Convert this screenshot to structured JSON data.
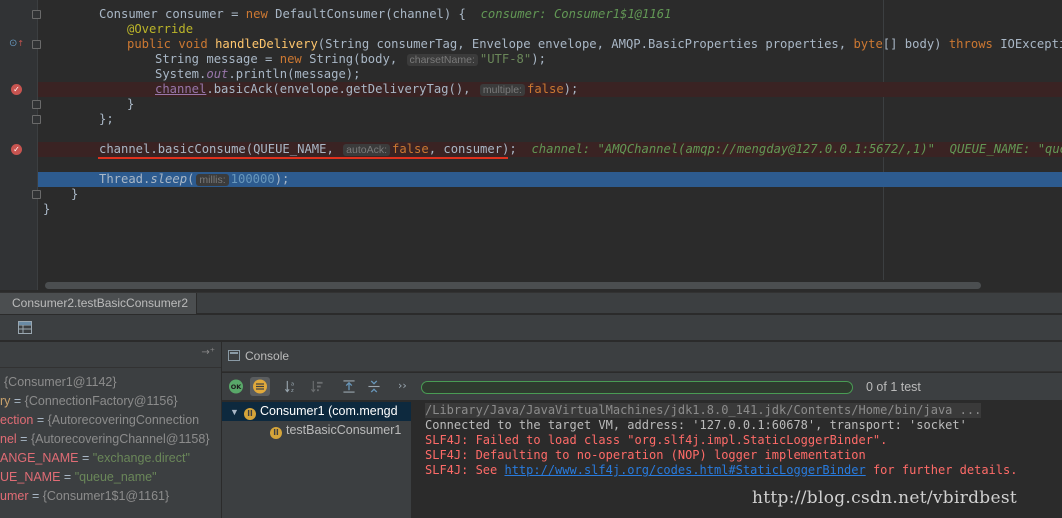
{
  "editor": {
    "lines": {
      "l1": {
        "kw_new": "new",
        "type": "Consumer",
        "var": "consumer",
        "eq": " = ",
        "cls": "DefaultConsumer",
        "args": "(channel) {",
        "inline": "consumer: Consumer1$1@1161"
      },
      "l2": {
        "annotation": "@Override"
      },
      "l3": {
        "kw": "public void",
        "method": "handleDelivery",
        "params_a": "(String consumerTag, Envelope envelope, AMQP.BasicProperties properties, ",
        "kw_byte": "byte",
        "params_b": "[] body) ",
        "kw_throws": "throws",
        "params_c": " IOException {"
      },
      "l4": {
        "pre": "String message = ",
        "kw_new": "new",
        "mid": " String(body, ",
        "hint": "charsetName:",
        "str": "\"UTF-8\"",
        "post": ");"
      },
      "l5": {
        "pre": "System.",
        "field": "out",
        "post": ".println(message);"
      },
      "l6": {
        "field": "channel",
        "mid": ".basicAck(envelope.getDeliveryTag(), ",
        "hint": "multiple:",
        "kw": "false",
        "post": ");"
      },
      "l7": {
        "text": "}"
      },
      "l8": {
        "text": "};"
      },
      "l9": {
        "pre": "channel.basicConsume(QUEUE_NAME, ",
        "hint": "autoAck:",
        "kw": "false",
        "post": ", consumer);",
        "inline": "channel: \"AMQChannel(amqp://mengday@127.0.0.1:5672/,1)\"  QUEUE_NAME: \"queue_na"
      },
      "l10": {
        "pre": "Thread.",
        "method": "sleep",
        "open": "(",
        "hint": "millis:",
        "num": "100000",
        "post": ");"
      },
      "l11": {
        "text": "}"
      },
      "l12": {
        "text": "}"
      }
    }
  },
  "debug": {
    "tab_label": "Consumer2.testBasicConsumer2",
    "variables": [
      {
        "name": "",
        "value": "{Consumer1@1142}"
      },
      {
        "name": "ry",
        "value": "{ConnectionFactory@1156}"
      },
      {
        "name": "ection",
        "value": "{AutorecoveringConnection"
      },
      {
        "name": "nel",
        "value": "{AutorecoveringChannel@1158}"
      },
      {
        "name": "ANGE_NAME",
        "value": "\"exchange.direct\""
      },
      {
        "name": "UE_NAME",
        "value": "\"queue_name\""
      },
      {
        "name": "umer",
        "value": "{Consumer1$1@1161}"
      }
    ],
    "variable_eq": " = "
  },
  "console": {
    "title": "Console",
    "test_count": "0 of 1 test",
    "tree": [
      {
        "label": "Consumer1 (com.mengd"
      },
      {
        "label": "testBasicConsumer1"
      }
    ],
    "output": {
      "cmd": "/Library/Java/JavaVirtualMachines/jdk1.8.0_141.jdk/Contents/Home/bin/java ...",
      "connected": "Connected to the target VM, address: '127.0.0.1:60678', transport: 'socket'",
      "err1": "SLF4J: Failed to load class \"org.slf4j.impl.StaticLoggerBinder\".",
      "err2": "SLF4J: Defaulting to no-operation (NOP) logger implementation",
      "err3_pre": "SLF4J: See ",
      "err3_link": "http://www.slf4j.org/codes.html#StaticLoggerBinder",
      "err3_post": " for further details."
    }
  },
  "watermark": "http://blog.csdn.net/vbirdbest",
  "colors": {
    "breakpoint": "#c75450",
    "selection": "#2d5b8f",
    "error_text": "#ff6b68",
    "link": "#287bde",
    "progress_border": "#499c54"
  }
}
